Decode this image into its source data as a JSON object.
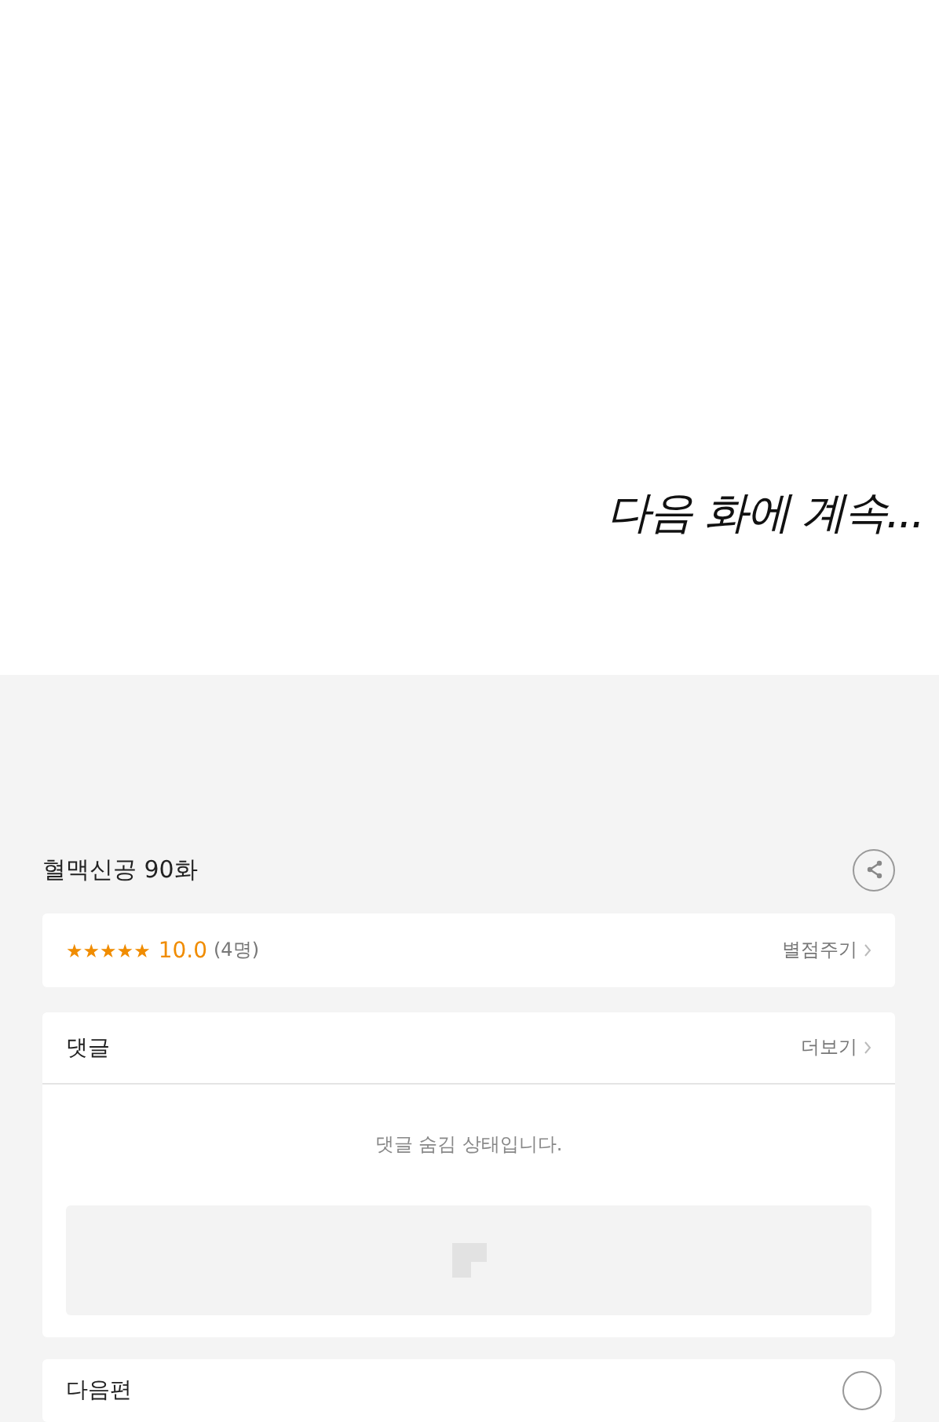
{
  "episode_end": {
    "text": "다음 화에 계속..."
  },
  "episode_title": "혈맥신공 90화",
  "rating": {
    "stars": 5,
    "score": "10.0",
    "count": "(4명)",
    "action": "별점주기"
  },
  "comments": {
    "title": "댓글",
    "more": "더보기",
    "message": "댓글 숨김 상태입니다."
  },
  "next": {
    "title": "다음편"
  }
}
